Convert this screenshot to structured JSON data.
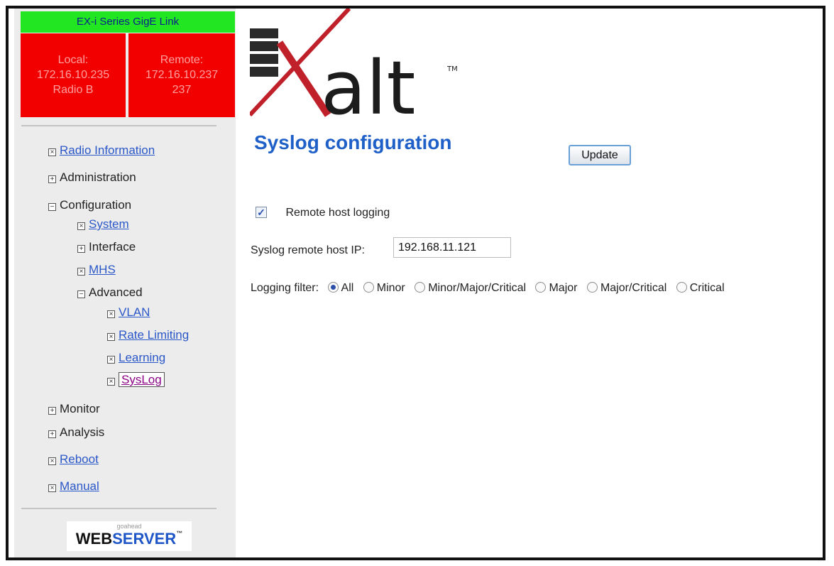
{
  "status": {
    "title": "EX-i Series GigE Link",
    "local": {
      "line1": "Local:",
      "line2": "172.16.10.235",
      "line3": "Radio B"
    },
    "remote": {
      "line1": "Remote:",
      "line2": "172.16.10.237",
      "line3": "237"
    }
  },
  "nav": {
    "radio_information": "Radio Information",
    "administration": "Administration",
    "configuration": "Configuration",
    "system": "System",
    "interface": "Interface",
    "mhs": "MHS",
    "advanced": "Advanced",
    "vlan": "VLAN",
    "rate_limiting": "Rate Limiting",
    "learning": "Learning",
    "syslog": "SysLog",
    "monitor": "Monitor",
    "analysis": "Analysis",
    "reboot": "Reboot",
    "manual": "Manual"
  },
  "footer_logo": {
    "small": "goahead",
    "web": "WEB",
    "server": "SERVER"
  },
  "brand": {
    "text": "alt",
    "tm": "TM",
    "accent": "#c0202a"
  },
  "main": {
    "title": "Syslog configuration",
    "update_label": "Update",
    "remote_logging_label": "Remote host logging",
    "remote_logging_checked": true,
    "host_ip_label": "Syslog remote host IP:",
    "host_ip_value": "192.168.11.121",
    "filter_label": "Logging filter:",
    "filter_options": [
      "All",
      "Minor",
      "Minor/Major/Critical",
      "Major",
      "Major/Critical",
      "Critical"
    ],
    "filter_selected": "All"
  }
}
